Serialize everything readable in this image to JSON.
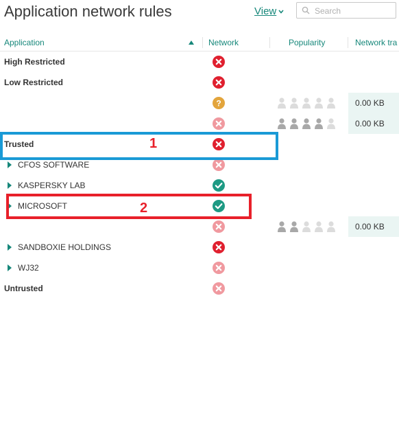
{
  "page": {
    "title": "Application network rules"
  },
  "toolbar": {
    "view_label": "View"
  },
  "search": {
    "placeholder": "Search",
    "value": ""
  },
  "columns": {
    "application": "Application",
    "network": "Network",
    "popularity": "Popularity",
    "traffic": "Network tra"
  },
  "rows": [
    {
      "label": "High Restricted",
      "kind": "group",
      "status": "deny"
    },
    {
      "label": "Low Restricted",
      "kind": "group",
      "status": "deny"
    },
    {
      "label": "",
      "kind": "app",
      "status": "ask",
      "popularity": 0,
      "traffic": "0.00 KB"
    },
    {
      "label": "",
      "kind": "app",
      "status": "deny-inherited",
      "popularity": 4,
      "traffic": "0.00 KB"
    },
    {
      "label": "Trusted",
      "kind": "group",
      "status": "deny"
    },
    {
      "label": "CFOS SOFTWARE",
      "kind": "vendor",
      "status": "deny-inherited"
    },
    {
      "label": "KASPERSKY LAB",
      "kind": "vendor",
      "status": "allow"
    },
    {
      "label": "MICROSOFT",
      "kind": "vendor",
      "status": "allow"
    },
    {
      "label": "",
      "kind": "app",
      "status": "deny-inherited",
      "popularity": 2,
      "traffic": "0.00 KB"
    },
    {
      "label": "SANDBOXIE HOLDINGS",
      "kind": "vendor",
      "status": "deny"
    },
    {
      "label": "WJ32",
      "kind": "vendor",
      "status": "deny-inherited"
    },
    {
      "label": "Untrusted",
      "kind": "group",
      "status": "deny-inherited"
    }
  ],
  "annotations": [
    {
      "number": "1",
      "color": "#1a9ad6"
    },
    {
      "number": "2",
      "color": "#e8202a"
    }
  ],
  "colors": {
    "accent": "#16877a",
    "deny": "#e0202f",
    "deny_inherited": "#f0999f",
    "allow": "#1e9a84",
    "ask": "#e3a53c"
  }
}
